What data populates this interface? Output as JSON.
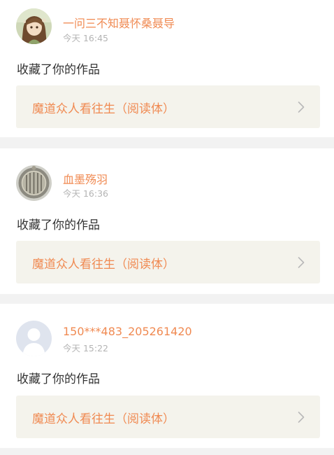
{
  "feed": {
    "items": [
      {
        "username": "一问三不知聂怀桑聂导",
        "time": "今天 16:45",
        "action": "收藏了你的作品",
        "work_title": "魔道众人看往生（阅读体）",
        "avatar_icon": "anime-avatar-icon",
        "chevron_icon": "chevron-right-icon"
      },
      {
        "username": "血墨殇羽",
        "time": "今天 16:36",
        "action": "收藏了你的作品",
        "work_title": "魔道众人看往生（阅读体）",
        "avatar_icon": "ornament-avatar-icon",
        "chevron_icon": "chevron-right-icon"
      },
      {
        "username": "150***483_205261420",
        "time": "今天 15:22",
        "action": "收藏了你的作品",
        "work_title": "魔道众人看往生（阅读体）",
        "avatar_icon": "default-user-avatar-icon",
        "chevron_icon": "chevron-right-icon"
      }
    ]
  },
  "colors": {
    "accent": "#f08a52",
    "timestamp": "#b4b4b4",
    "text": "#333333",
    "link_background": "#f4f3ec",
    "page_background": "#f2f2f2",
    "card_background": "#ffffff"
  }
}
